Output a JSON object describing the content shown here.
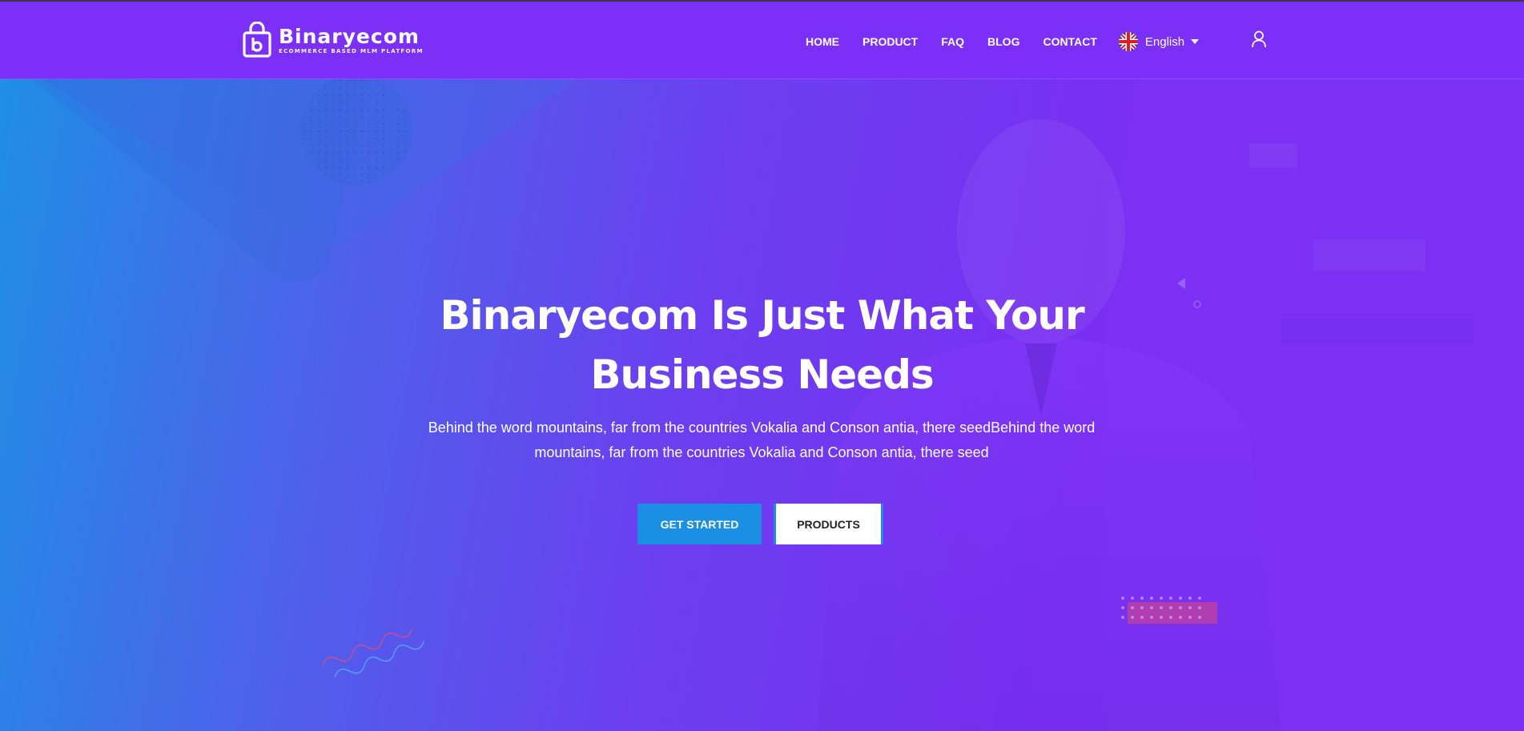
{
  "header": {
    "brand_name": "Binaryecom",
    "brand_tagline": "ECOMMERCE BASED MLM PLATFORM",
    "nav": [
      {
        "label": "HOME"
      },
      {
        "label": "PRODUCT"
      },
      {
        "label": "FAQ"
      },
      {
        "label": "BLOG"
      },
      {
        "label": "CONTACT"
      }
    ],
    "language": "English"
  },
  "hero": {
    "title_line1": "Binaryecom Is Just What Your",
    "title_line2": "Business Needs",
    "subtitle": "Behind the word mountains, far from the countries Vokalia and Conson antia, there seedBehind the word mountains, far from the countries Vokalia and Conson antia, there seed",
    "primary_button": "GET STARTED",
    "secondary_button": "PRODUCTS"
  },
  "colors": {
    "header_bg": "#7b2ff7",
    "primary_button": "#1a8fe3",
    "gradient_start": "#1f8ee6",
    "gradient_end": "#7b2ff0"
  },
  "icons": {
    "logo": "shopping-bag-icon",
    "language_flag": "uk-flag-icon",
    "dropdown": "caret-down-icon",
    "account": "user-icon"
  }
}
